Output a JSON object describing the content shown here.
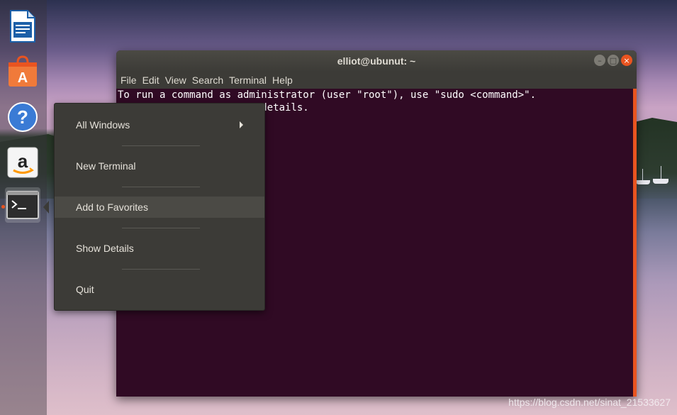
{
  "window": {
    "title": "elliot@ubunut: ~",
    "controls": [
      "minimize",
      "maximize",
      "close"
    ]
  },
  "menubar": {
    "items": [
      "File",
      "Edit",
      "View",
      "Search",
      "Terminal",
      "Help"
    ]
  },
  "terminal": {
    "lines": [
      "To run a command as administrator (user \"root\"), use \"sudo <command>\".",
      "See \"man sudo_root\" for details."
    ]
  },
  "context_menu": {
    "items": [
      {
        "label": "All Windows",
        "has_submenu": true
      },
      {
        "label": "New Terminal"
      },
      {
        "label": "Add to Favorites",
        "highlighted": true
      },
      {
        "label": "Show Details"
      },
      {
        "label": "Quit"
      }
    ]
  },
  "launcher": {
    "items": [
      {
        "icon": "libreoffice-writer-icon"
      },
      {
        "icon": "ubuntu-software-icon"
      },
      {
        "icon": "help-icon"
      },
      {
        "icon": "amazon-icon"
      },
      {
        "icon": "terminal-icon",
        "running": true
      }
    ]
  },
  "watermark": "https://blog.csdn.net/sinat_21533627",
  "colors": {
    "terminal_bg": "#300a24",
    "accent": "#e95420",
    "chrome": "#3c3b37"
  }
}
